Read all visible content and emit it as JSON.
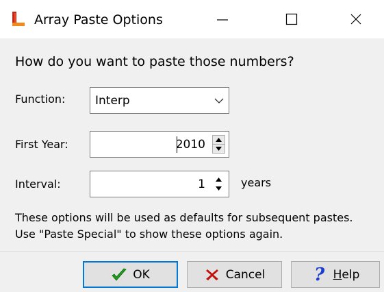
{
  "window": {
    "title": "Array Paste Options",
    "icon": "app-logo-icon",
    "controls": [
      "minimize-icon",
      "maximize-icon",
      "close-icon"
    ]
  },
  "prompt": "How do you want to paste those numbers?",
  "form": {
    "function": {
      "label": "Function:",
      "value": "Interp"
    },
    "first_year": {
      "label": "First Year:",
      "value": "2010"
    },
    "interval": {
      "label": "Interval:",
      "value": "1",
      "unit": "years"
    }
  },
  "info": {
    "line1": "These options will be used as defaults for subsequent pastes.",
    "line2": "Use \"Paste Special\" to show these options again."
  },
  "buttons": {
    "ok": {
      "label": "OK",
      "icon": "checkmark-icon"
    },
    "cancel": {
      "label": "Cancel",
      "icon": "x-mark-icon"
    },
    "help": {
      "label": "Help",
      "icon": "question-mark-icon"
    }
  },
  "colors": {
    "focus_border": "#0078d7",
    "ok_check": "#1f9b1f",
    "cancel_x": "#c0120c",
    "help_q": "#1c3ccf",
    "logo_red": "#c2291b",
    "logo_orange": "#f08a1c"
  }
}
